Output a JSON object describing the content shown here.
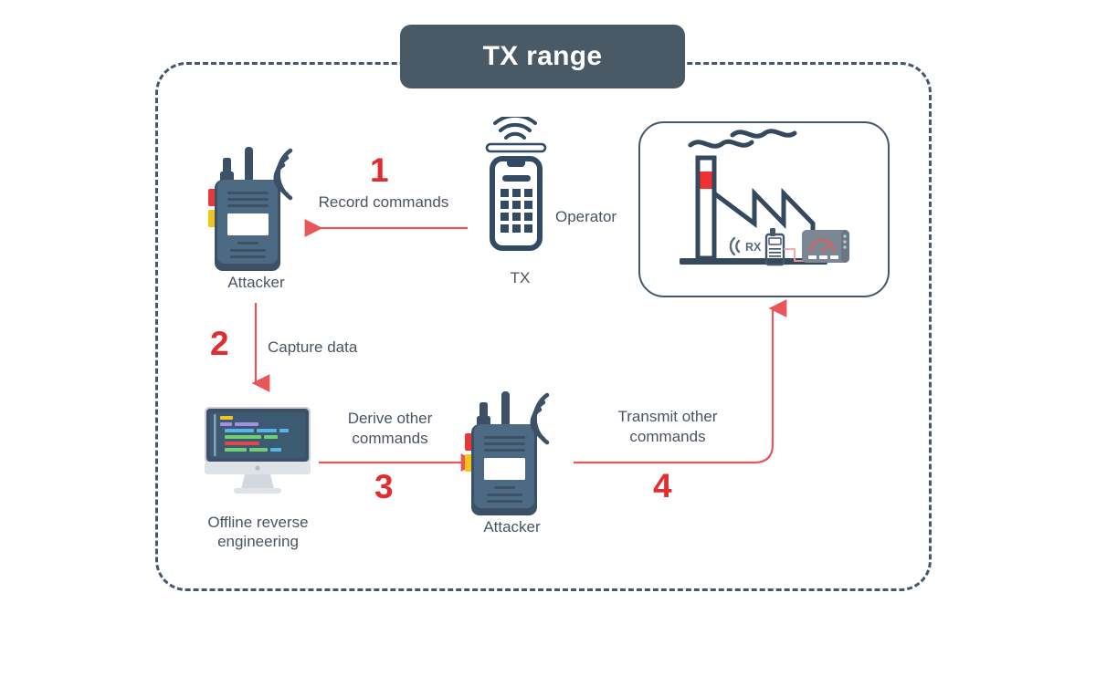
{
  "diagram": {
    "title": "TX range",
    "accent_red": "#e12d30",
    "ink_slate": "#46576b",
    "text_gray": "#4a5461",
    "pill_bg": "#4a5966"
  },
  "nodes": {
    "attacker_top": {
      "label": "Attacker",
      "icon": "walkie-talkie-icon"
    },
    "tx": {
      "label": "TX",
      "icon": "tx-remote-icon"
    },
    "operator": {
      "label": "Operator"
    },
    "factory": {
      "icon": "factory-icon",
      "rx_label": "RX"
    },
    "computer": {
      "label": "Offline reverse\nengineering",
      "icon": "desktop-monitor-icon"
    },
    "attacker_bottom": {
      "label": "Attacker",
      "icon": "walkie-talkie-icon"
    }
  },
  "steps": [
    {
      "number": "1",
      "label": "Record commands"
    },
    {
      "number": "2",
      "label": "Capture data"
    },
    {
      "number": "3",
      "label": "Derive other\ncommands"
    },
    {
      "number": "4",
      "label": "Transmit other\ncommands"
    }
  ]
}
